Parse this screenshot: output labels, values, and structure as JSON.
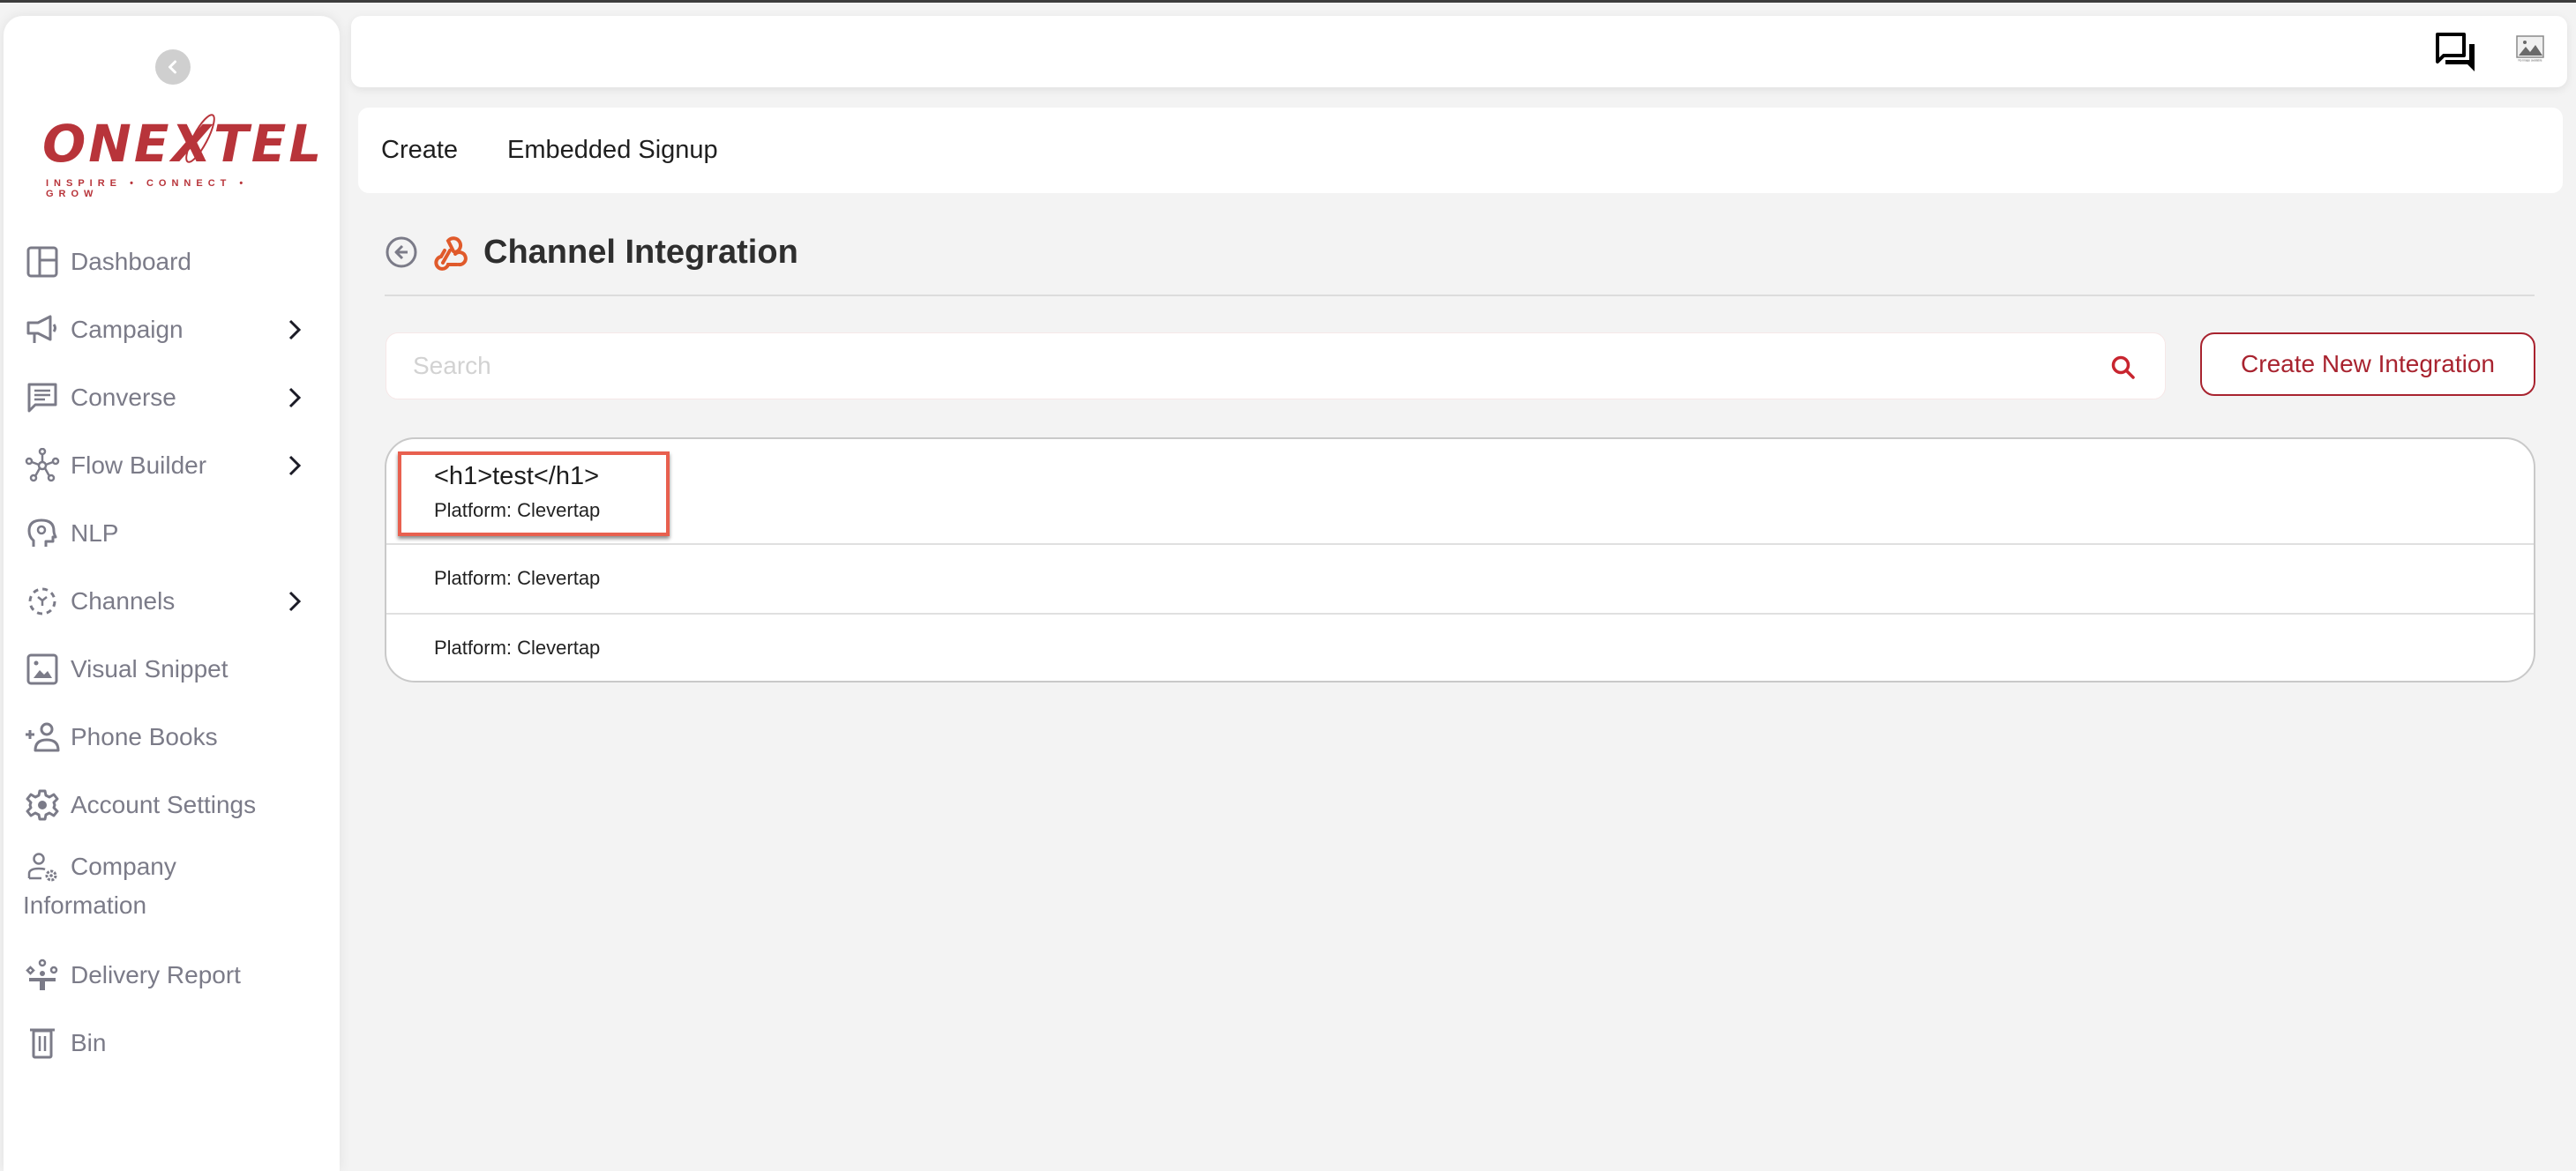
{
  "sidebar": {
    "collapse_icon": "chevron-left-icon",
    "logo": {
      "word": "ONEXTEL",
      "tagline": "INSPIRE • CONNECT • GROW"
    },
    "items": [
      {
        "label": "Dashboard",
        "icon": "dashboard-icon",
        "has_submenu": false
      },
      {
        "label": "Campaign",
        "icon": "megaphone-icon",
        "has_submenu": true
      },
      {
        "label": "Converse",
        "icon": "chat-icon",
        "has_submenu": true
      },
      {
        "label": "Flow Builder",
        "icon": "flow-nodes-icon",
        "has_submenu": true
      },
      {
        "label": "NLP",
        "icon": "brain-gear-icon",
        "has_submenu": false
      },
      {
        "label": "Channels",
        "icon": "channels-icon",
        "has_submenu": true
      },
      {
        "label": "Visual Snippet",
        "icon": "image-icon",
        "has_submenu": false
      },
      {
        "label": "Phone Books",
        "icon": "add-person-icon",
        "has_submenu": false
      },
      {
        "label": "Account Settings",
        "icon": "gear-icon",
        "has_submenu": false
      },
      {
        "label": "Company Information",
        "label_line1": "Company",
        "label_line2": "Information",
        "icon": "user-gear-icon",
        "has_submenu": false
      },
      {
        "label": "Delivery Report",
        "icon": "delivery-report-icon",
        "has_submenu": false
      },
      {
        "label": "Bin",
        "icon": "trash-icon",
        "has_submenu": false
      }
    ]
  },
  "topbar": {
    "icons": [
      "messages-icon",
      "image-placeholder-icon"
    ],
    "image_placeholder_caption": "No image available"
  },
  "tabs": [
    {
      "label": "Create"
    },
    {
      "label": "Embedded Signup"
    }
  ],
  "page": {
    "title": "Channel Integration",
    "back_icon": "back-arrow-icon",
    "title_icon": "webhook-icon",
    "accent_color": "#e05a2b"
  },
  "search": {
    "placeholder": "Search",
    "value": ""
  },
  "create_button": {
    "label": "Create New Integration",
    "color": "#a8232f"
  },
  "integrations": [
    {
      "name": "<h1>test</h1>",
      "platform": "Platform: Clevertap",
      "highlighted": true
    },
    {
      "name": "",
      "platform": "Platform: Clevertap",
      "highlighted": false
    },
    {
      "name": "",
      "platform": "Platform: Clevertap",
      "highlighted": false
    }
  ]
}
